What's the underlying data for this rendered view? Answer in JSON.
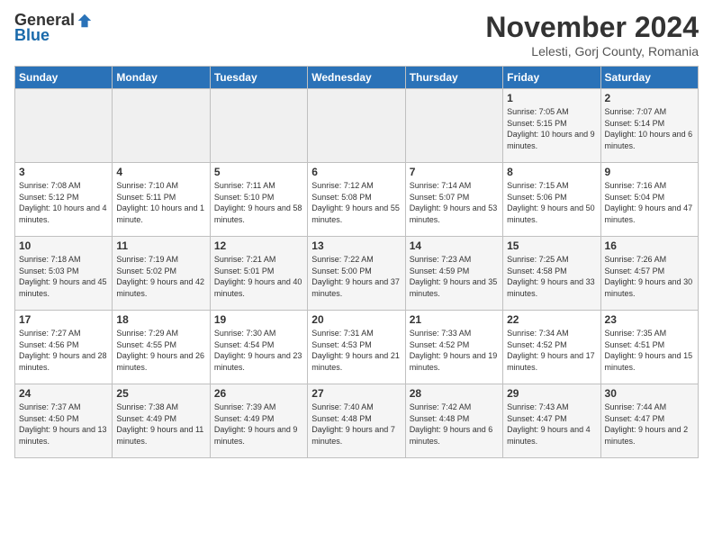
{
  "logo": {
    "general": "General",
    "blue": "Blue"
  },
  "title": "November 2024",
  "subtitle": "Lelesti, Gorj County, Romania",
  "days_of_week": [
    "Sunday",
    "Monday",
    "Tuesday",
    "Wednesday",
    "Thursday",
    "Friday",
    "Saturday"
  ],
  "weeks": [
    [
      {
        "day": "",
        "info": ""
      },
      {
        "day": "",
        "info": ""
      },
      {
        "day": "",
        "info": ""
      },
      {
        "day": "",
        "info": ""
      },
      {
        "day": "",
        "info": ""
      },
      {
        "day": "1",
        "info": "Sunrise: 7:05 AM\nSunset: 5:15 PM\nDaylight: 10 hours and 9 minutes."
      },
      {
        "day": "2",
        "info": "Sunrise: 7:07 AM\nSunset: 5:14 PM\nDaylight: 10 hours and 6 minutes."
      }
    ],
    [
      {
        "day": "3",
        "info": "Sunrise: 7:08 AM\nSunset: 5:12 PM\nDaylight: 10 hours and 4 minutes."
      },
      {
        "day": "4",
        "info": "Sunrise: 7:10 AM\nSunset: 5:11 PM\nDaylight: 10 hours and 1 minute."
      },
      {
        "day": "5",
        "info": "Sunrise: 7:11 AM\nSunset: 5:10 PM\nDaylight: 9 hours and 58 minutes."
      },
      {
        "day": "6",
        "info": "Sunrise: 7:12 AM\nSunset: 5:08 PM\nDaylight: 9 hours and 55 minutes."
      },
      {
        "day": "7",
        "info": "Sunrise: 7:14 AM\nSunset: 5:07 PM\nDaylight: 9 hours and 53 minutes."
      },
      {
        "day": "8",
        "info": "Sunrise: 7:15 AM\nSunset: 5:06 PM\nDaylight: 9 hours and 50 minutes."
      },
      {
        "day": "9",
        "info": "Sunrise: 7:16 AM\nSunset: 5:04 PM\nDaylight: 9 hours and 47 minutes."
      }
    ],
    [
      {
        "day": "10",
        "info": "Sunrise: 7:18 AM\nSunset: 5:03 PM\nDaylight: 9 hours and 45 minutes."
      },
      {
        "day": "11",
        "info": "Sunrise: 7:19 AM\nSunset: 5:02 PM\nDaylight: 9 hours and 42 minutes."
      },
      {
        "day": "12",
        "info": "Sunrise: 7:21 AM\nSunset: 5:01 PM\nDaylight: 9 hours and 40 minutes."
      },
      {
        "day": "13",
        "info": "Sunrise: 7:22 AM\nSunset: 5:00 PM\nDaylight: 9 hours and 37 minutes."
      },
      {
        "day": "14",
        "info": "Sunrise: 7:23 AM\nSunset: 4:59 PM\nDaylight: 9 hours and 35 minutes."
      },
      {
        "day": "15",
        "info": "Sunrise: 7:25 AM\nSunset: 4:58 PM\nDaylight: 9 hours and 33 minutes."
      },
      {
        "day": "16",
        "info": "Sunrise: 7:26 AM\nSunset: 4:57 PM\nDaylight: 9 hours and 30 minutes."
      }
    ],
    [
      {
        "day": "17",
        "info": "Sunrise: 7:27 AM\nSunset: 4:56 PM\nDaylight: 9 hours and 28 minutes."
      },
      {
        "day": "18",
        "info": "Sunrise: 7:29 AM\nSunset: 4:55 PM\nDaylight: 9 hours and 26 minutes."
      },
      {
        "day": "19",
        "info": "Sunrise: 7:30 AM\nSunset: 4:54 PM\nDaylight: 9 hours and 23 minutes."
      },
      {
        "day": "20",
        "info": "Sunrise: 7:31 AM\nSunset: 4:53 PM\nDaylight: 9 hours and 21 minutes."
      },
      {
        "day": "21",
        "info": "Sunrise: 7:33 AM\nSunset: 4:52 PM\nDaylight: 9 hours and 19 minutes."
      },
      {
        "day": "22",
        "info": "Sunrise: 7:34 AM\nSunset: 4:52 PM\nDaylight: 9 hours and 17 minutes."
      },
      {
        "day": "23",
        "info": "Sunrise: 7:35 AM\nSunset: 4:51 PM\nDaylight: 9 hours and 15 minutes."
      }
    ],
    [
      {
        "day": "24",
        "info": "Sunrise: 7:37 AM\nSunset: 4:50 PM\nDaylight: 9 hours and 13 minutes."
      },
      {
        "day": "25",
        "info": "Sunrise: 7:38 AM\nSunset: 4:49 PM\nDaylight: 9 hours and 11 minutes."
      },
      {
        "day": "26",
        "info": "Sunrise: 7:39 AM\nSunset: 4:49 PM\nDaylight: 9 hours and 9 minutes."
      },
      {
        "day": "27",
        "info": "Sunrise: 7:40 AM\nSunset: 4:48 PM\nDaylight: 9 hours and 7 minutes."
      },
      {
        "day": "28",
        "info": "Sunrise: 7:42 AM\nSunset: 4:48 PM\nDaylight: 9 hours and 6 minutes."
      },
      {
        "day": "29",
        "info": "Sunrise: 7:43 AM\nSunset: 4:47 PM\nDaylight: 9 hours and 4 minutes."
      },
      {
        "day": "30",
        "info": "Sunrise: 7:44 AM\nSunset: 4:47 PM\nDaylight: 9 hours and 2 minutes."
      }
    ]
  ]
}
